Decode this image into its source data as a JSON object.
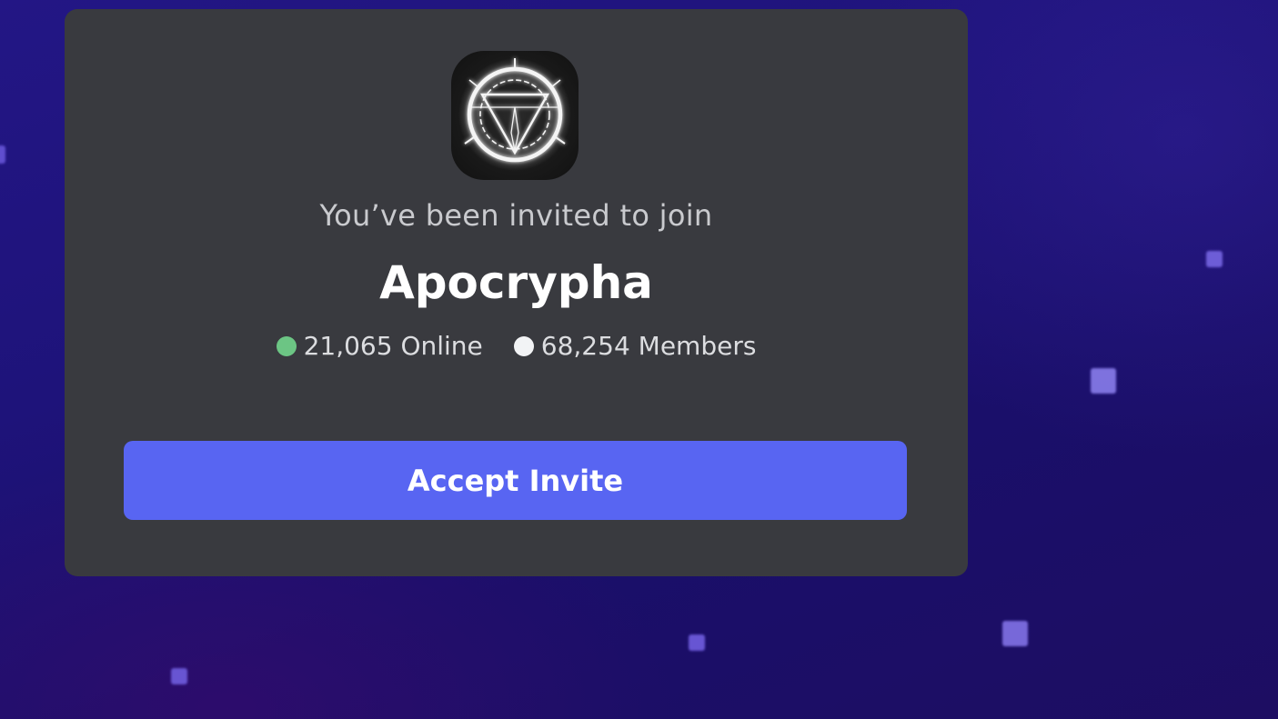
{
  "invite": {
    "intro_text": "You’ve been invited to join",
    "server_name": "Apocrypha",
    "online_count": "21,065 Online",
    "member_count": "68,254 Members",
    "accept_label": "Accept Invite"
  },
  "icons": {
    "server_icon": "occult-circle-triangle-emblem",
    "online_indicator": "green-dot-icon",
    "members_indicator": "white-dot-icon"
  },
  "colors": {
    "background": "#1e137a",
    "card": "#393a3f",
    "accent_button": "#5865f2",
    "online_dot": "#6cc584",
    "members_dot": "#f2f3f5"
  }
}
